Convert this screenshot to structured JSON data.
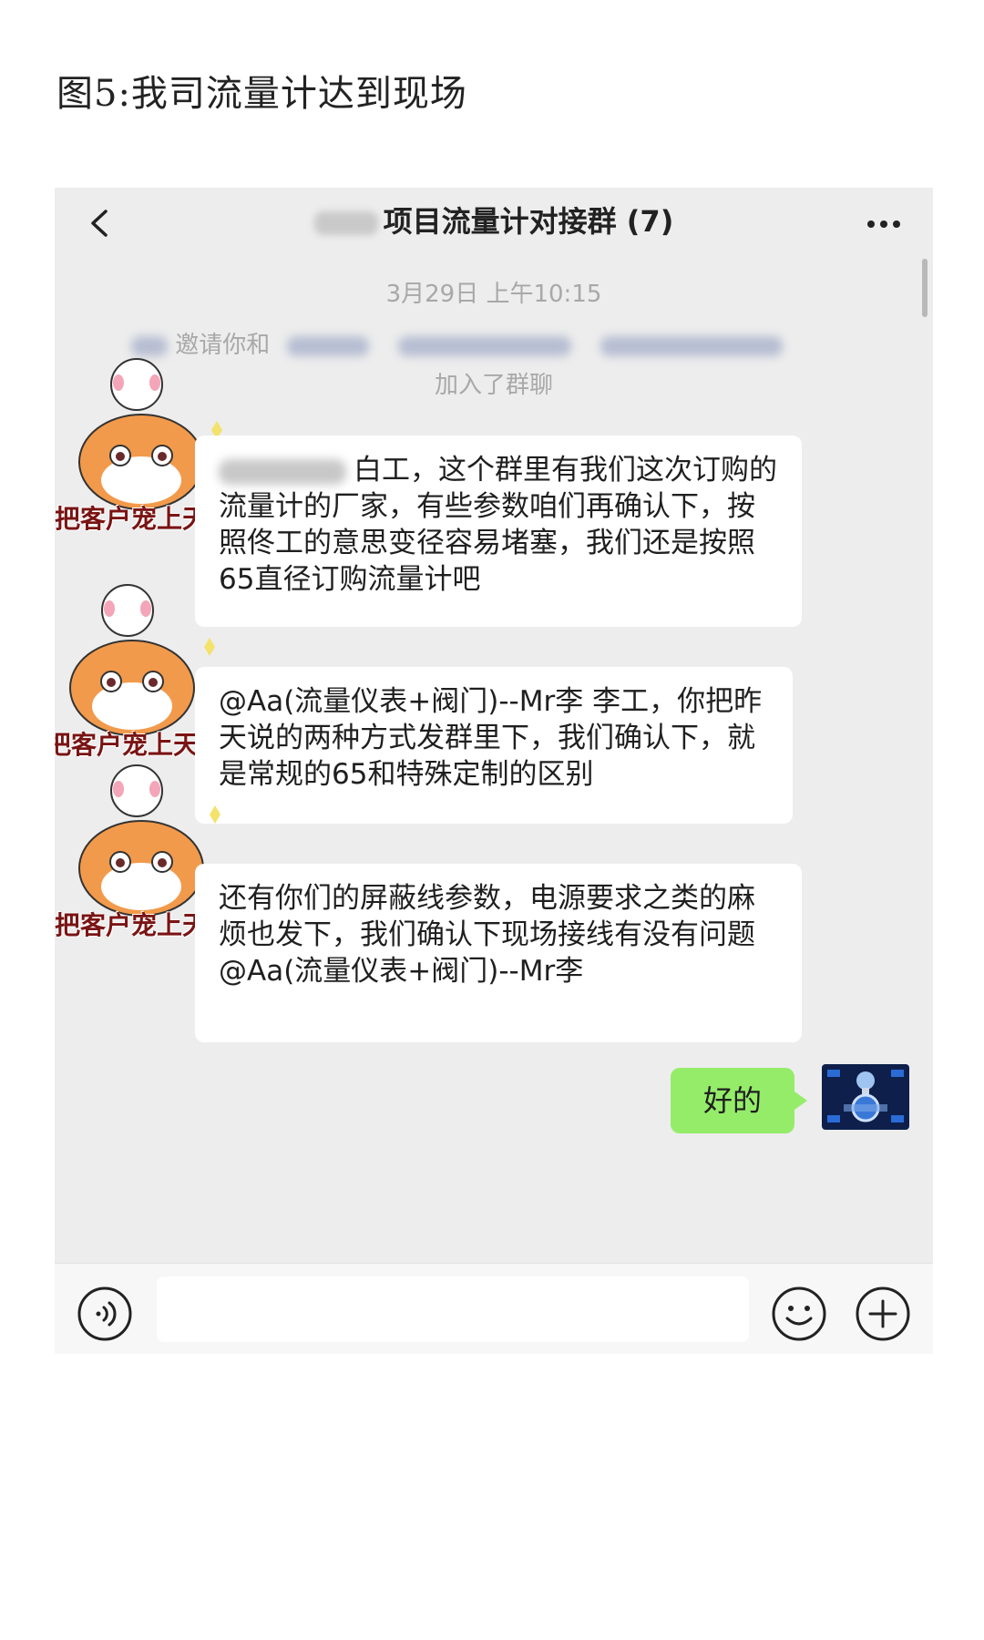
{
  "caption": "图5:我司流量计达到现场",
  "header": {
    "title": "项目流量计对接群 (7)"
  },
  "system": {
    "timestamp": "3月29日 上午10:15",
    "invite_prefix": "邀请你和",
    "invite_suffix": "加入了群聊"
  },
  "messages": [
    {
      "sticker_text": "把客户宠上天",
      "text": "白工，这个群里有我们这次订购的流量计的厂家，有些参数咱们再确认下，按照佟工的意思变径容易堵塞，我们还是按照65直径订购流量计吧"
    },
    {
      "sticker_text": "把客户宠上天",
      "text": "@Aa(流量仪表+阀门)--Mr李 李工，你把昨天说的两种方式发群里下，我们确认下，就是常规的65和特殊定制的区别"
    },
    {
      "sticker_text": "把客户宠上天",
      "text": "还有你们的屏蔽线参数，电源要求之类的麻烦也发下，我们确认下现场接线有没有问题 @Aa(流量仪表+阀门)--Mr李"
    }
  ],
  "my_reply": "好的",
  "input": {
    "value": ""
  },
  "icons": {
    "back": "chevron-left-icon",
    "more": "more-dots-icon",
    "voice": "voice-icon",
    "emoji": "emoji-icon",
    "plus": "plus-icon"
  },
  "colors": {
    "chat_background": "#ededed",
    "my_bubble": "#95ec69",
    "other_bubble": "#ffffff",
    "sticker_text": "#7a1414"
  }
}
